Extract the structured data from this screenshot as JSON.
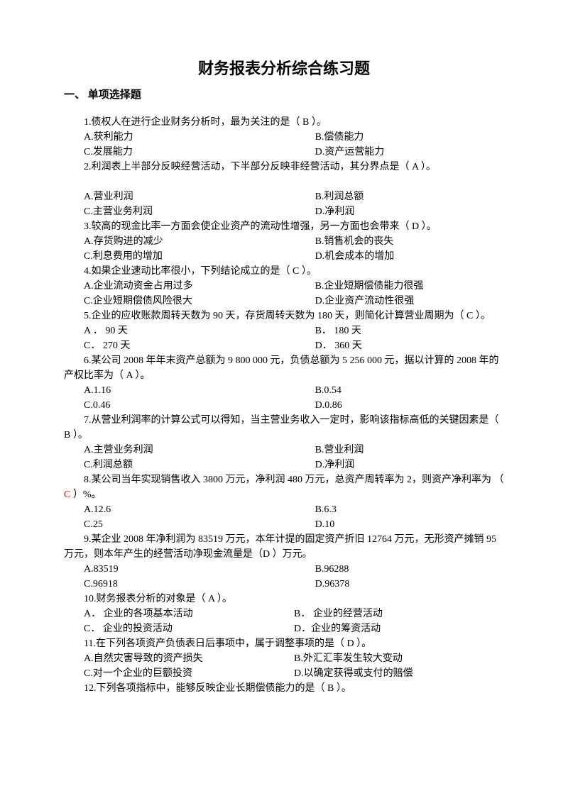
{
  "title": "财务报表分析综合练习题",
  "section1": "一、 单项选择题",
  "q1": {
    "text": "1.债权人在进行企业财务分析时，最为关注的是（ B  ）。",
    "a": "A.获利能力",
    "b": "B.偿债能力",
    "c": "C.发展能力",
    "d": "D.资产运营能力"
  },
  "q2": {
    "text": "2.利润表上半部分反映经营活动，下半部分反映非经营活动，其分界点是（   A   ）。",
    "a": "A.营业利润",
    "b": "B.利润总额",
    "c": "C.主营业务利润",
    "d": "D.净利润"
  },
  "q3": {
    "text": "3.较高的现金比率一方面会使企业资产的流动性增强，另一方面也会带来（  D  ）。",
    "a": "A.存货购进的减少",
    "b": "B.销售机会的丧失",
    "c": "C.利息费用的增加",
    "d": "D.机会成本的增加"
  },
  "q4": {
    "text": "4.如果企业速动比率很小，下列结论成立的是（  C  ）。",
    "a": "A.企业流动资金占用过多",
    "b": "B.企业短期偿债能力很强",
    "c": "C.企业短期偿债风险很大",
    "d": "D.企业资产流动性很强"
  },
  "q5": {
    "text": "5.企业的应收账款周转天数为 90 天，存货周转天数为 180 天，则简化计算营业周期为（   C ）。",
    "a": "A ． 90 天",
    "b": "B． 180 天",
    "c": "C． 270 天",
    "d": "D． 360 天"
  },
  "q6": {
    "text": "6.某公司 2008 年年末资产总额为 9 800 000 元，负债总额为 5 256 000 元，据以计算的 2008 年的产权比率为（   A  ）。",
    "a": "A.1.16",
    "b": "B.0.54",
    "c": "C.0.46",
    "d": "D.0.86"
  },
  "q7": {
    "text": "7.从营业利润率的计算公式可以得知，当主营业务收入一定时，影响该指标高低的关键因素是（    B  ）。",
    "a": "A.主营业务利润",
    "b": "B.营业利润",
    "c": "C.利润总额",
    "d": "D.净利润"
  },
  "q8": {
    "text1": "8.某公司当年实现销售收入 3800 万元，净利润 480 万元，总资产周转率为 2，则资产净利率为 （  ",
    "ans": "C",
    "text2": "  ）%。",
    "a": "A.12.6",
    "b": "B.6.3",
    "c": "C.25",
    "d": "D.10"
  },
  "q9": {
    "text": "9.某企业 2008 年净利润为 83519 万元，本年计提的固定资产折旧 12764 万元，无形资产摊销 95 万元，则本年产生的经营活动净现金流量是（D    ）万元。",
    "a": "A.83519",
    "b": "B.96288",
    "c": "C.96918",
    "d": "D.96378"
  },
  "q10": {
    "text": "10.财务报表分析的对象是（   A    ）。",
    "a": "A． 企业的各项基本活动",
    "b": "B． 企业的经营活动",
    "c": "C． 企业的投资活动",
    "d": "D．企业的筹资活动"
  },
  "q11": {
    "text": "11.在下列各项资产负债表日后事项中，属于调整事项的是（   D   ）。",
    "a": "A.自然灾害导致的资产损失",
    "b": "B.外汇汇率发生较大变动",
    "c": "C.对一个企业的巨额投资",
    "d": "D.以确定获得或支付的赔偿"
  },
  "q12": {
    "text": "12.下列各项指标中，能够反映企业长期偿债能力的是（   B   ）。"
  }
}
